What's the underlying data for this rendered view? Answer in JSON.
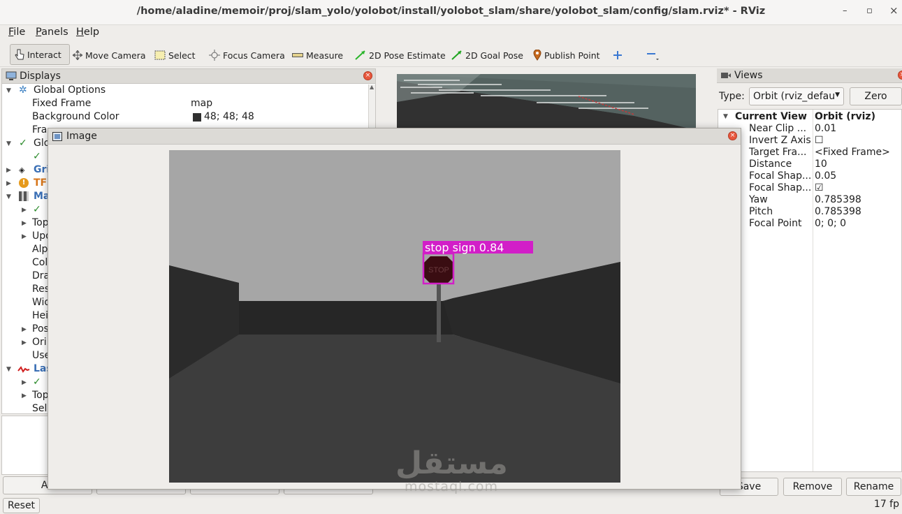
{
  "window": {
    "title": "/home/aladine/memoir/proj/slam_yolo/yolobot/install/yolobot_slam/share/yolobot_slam/config/slam.rviz* - RViz",
    "minimize": "–",
    "maximize": "▫",
    "close": "×"
  },
  "menu": {
    "file": "File",
    "panels": "Panels",
    "help": "Help"
  },
  "toolbar": {
    "interact": "Interact",
    "move_camera": "Move Camera",
    "select": "Select",
    "focus_camera": "Focus Camera",
    "measure": "Measure",
    "pose_estimate": "2D Pose Estimate",
    "goal_pose": "2D Goal Pose",
    "publish_point": "Publish Point"
  },
  "displays": {
    "title": "Displays",
    "global_options": "Global Options",
    "fixed_frame_label": "Fixed Frame",
    "fixed_frame_value": "map",
    "background_label": "Background Color",
    "background_value": "48; 48; 48",
    "background_color": "#303030",
    "frame_rate_label": "Fra",
    "global_status": "Glo",
    "grid": "Gri",
    "tf": "TF",
    "map": "Ma",
    "map_children": [
      "Top",
      "Upd",
      "Alp",
      "Col",
      "Dra",
      "Res",
      "Wid",
      "Hei",
      "Pos",
      "Ori",
      "Use"
    ],
    "laser": "Las",
    "laser_children": [
      "Top",
      "Sel"
    ],
    "add_button": "Ad",
    "reset_button": "Reset"
  },
  "image_window": {
    "title": "Image",
    "detection_label": "stop sign 0.84",
    "sign_text": "STOP",
    "detection_color": "#d21ec8"
  },
  "views": {
    "title": "Views",
    "type_label": "Type:",
    "type_value": "Orbit (rviz_defau",
    "zero_button": "Zero",
    "current_view_label": "Current View",
    "current_view_value": "Orbit (rviz)",
    "props": [
      {
        "k": "Near Clip ...",
        "v": "0.01"
      },
      {
        "k": "Invert Z Axis",
        "v": "☐"
      },
      {
        "k": "Target Fra...",
        "v": "<Fixed Frame>"
      },
      {
        "k": "Distance",
        "v": "10"
      },
      {
        "k": "Focal Shap...",
        "v": "0.05"
      },
      {
        "k": "Focal Shap...",
        "v": "☑"
      },
      {
        "k": "Yaw",
        "v": "0.785398"
      },
      {
        "k": "Pitch",
        "v": "0.785398"
      },
      {
        "k": "Focal Point",
        "v": "0; 0; 0"
      }
    ],
    "save_button": "Save",
    "remove_button": "Remove",
    "rename_button": "Rename"
  },
  "status": {
    "fps": "17 fp"
  },
  "watermark": {
    "arabic": "مستقل",
    "latin": "mostaql.com"
  }
}
